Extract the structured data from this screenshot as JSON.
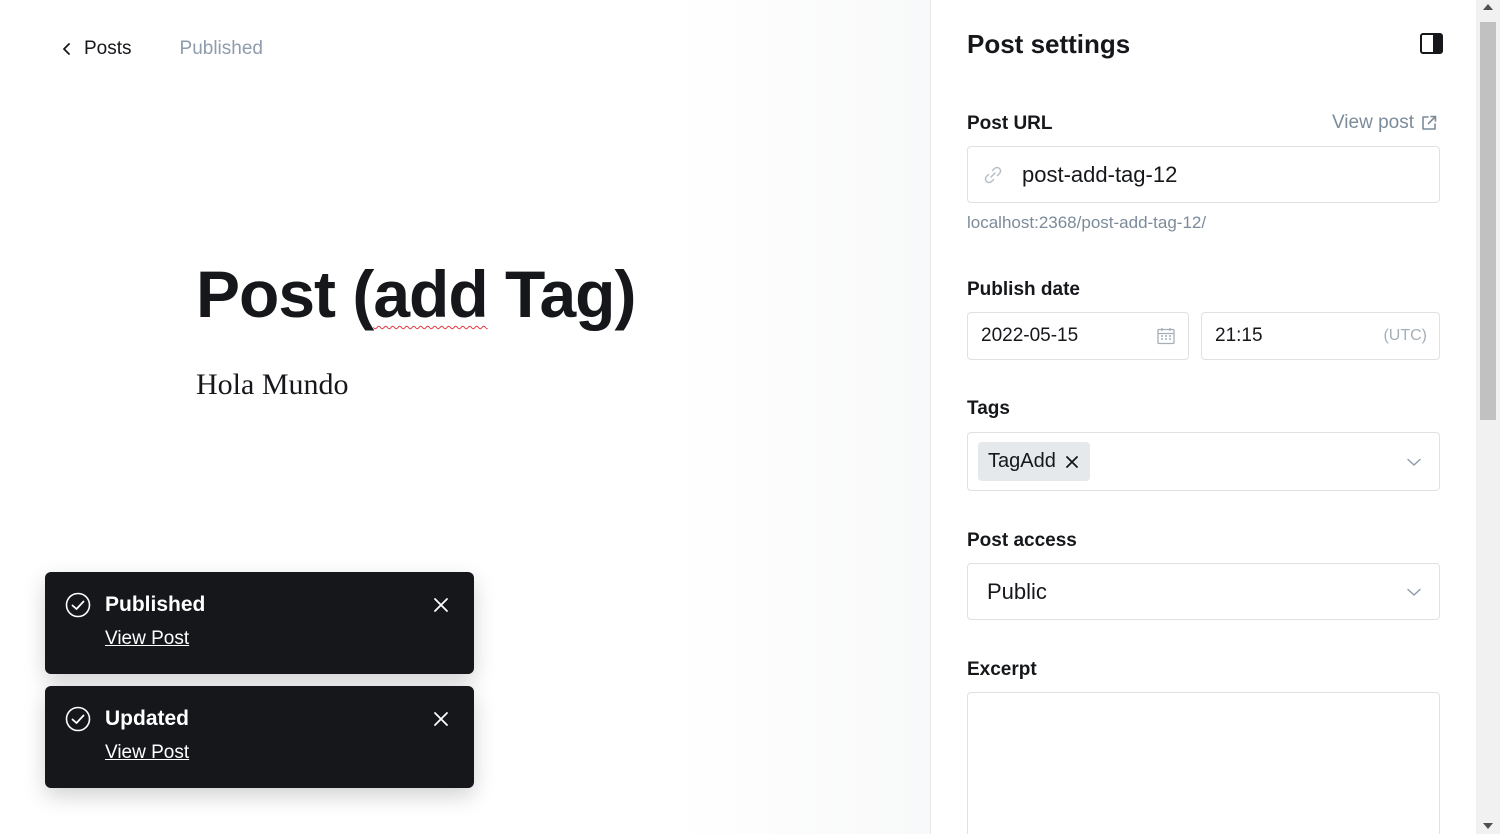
{
  "header": {
    "back_label": "Posts",
    "status": "Published"
  },
  "post": {
    "title_pre": "Post (",
    "title_typo": "add",
    "title_post": " Tag)",
    "body": "Hola Mundo"
  },
  "toasts": [
    {
      "title": "Published",
      "link": "View Post",
      "icons": [
        "check-circle-icon",
        "close-icon"
      ]
    },
    {
      "title": "Updated",
      "link": "View Post",
      "icons": [
        "check-circle-icon",
        "close-icon"
      ]
    }
  ],
  "settings": {
    "title": "Post settings",
    "post_url": {
      "label": "Post URL",
      "view_post": "View post",
      "value": "post-add-tag-12",
      "hint": "localhost:2368/post-add-tag-12/"
    },
    "publish_date": {
      "label": "Publish date",
      "date": "2022-05-15",
      "time": "21:15",
      "timezone": "(UTC)"
    },
    "tags": {
      "label": "Tags",
      "items": [
        "TagAdd"
      ]
    },
    "post_access": {
      "label": "Post access",
      "value": "Public"
    },
    "excerpt": {
      "label": "Excerpt",
      "value": ""
    }
  },
  "colors": {
    "toast_bg": "#15171a",
    "text": "#15171a",
    "muted": "#7c8b9a",
    "status": "#8e9cac",
    "tag_chip": "#e6e9eb",
    "border": "#dfe2e5"
  }
}
